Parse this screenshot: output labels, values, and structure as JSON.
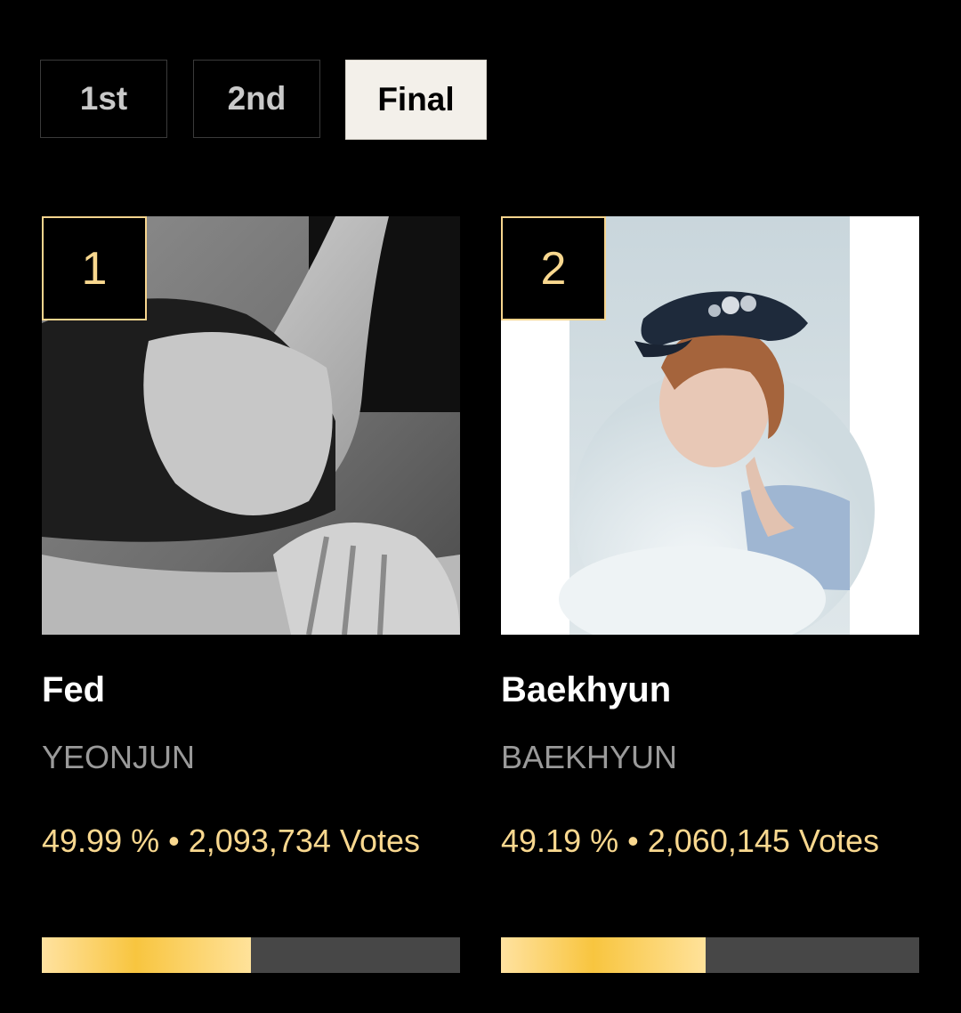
{
  "tabs": [
    {
      "label": "1st",
      "selected": false
    },
    {
      "label": "2nd",
      "selected": false
    },
    {
      "label": "Final",
      "selected": true
    }
  ],
  "candidates": [
    {
      "rank": "1",
      "title": "Fed",
      "artist": "YEONJUN",
      "percent": "49.99 %",
      "separator": "•",
      "votes": "2,093,734",
      "votes_label": "Votes",
      "bar_fraction": 0.5
    },
    {
      "rank": "2",
      "title": "Baekhyun",
      "artist": "BAEKHYUN",
      "percent": "49.19 %",
      "separator": "•",
      "votes": "2,060,145",
      "votes_label": "Votes",
      "bar_fraction": 0.49
    }
  ],
  "colors": {
    "accent_gold": "#f9d88f",
    "background": "#000000",
    "bar_track": "#474747"
  }
}
